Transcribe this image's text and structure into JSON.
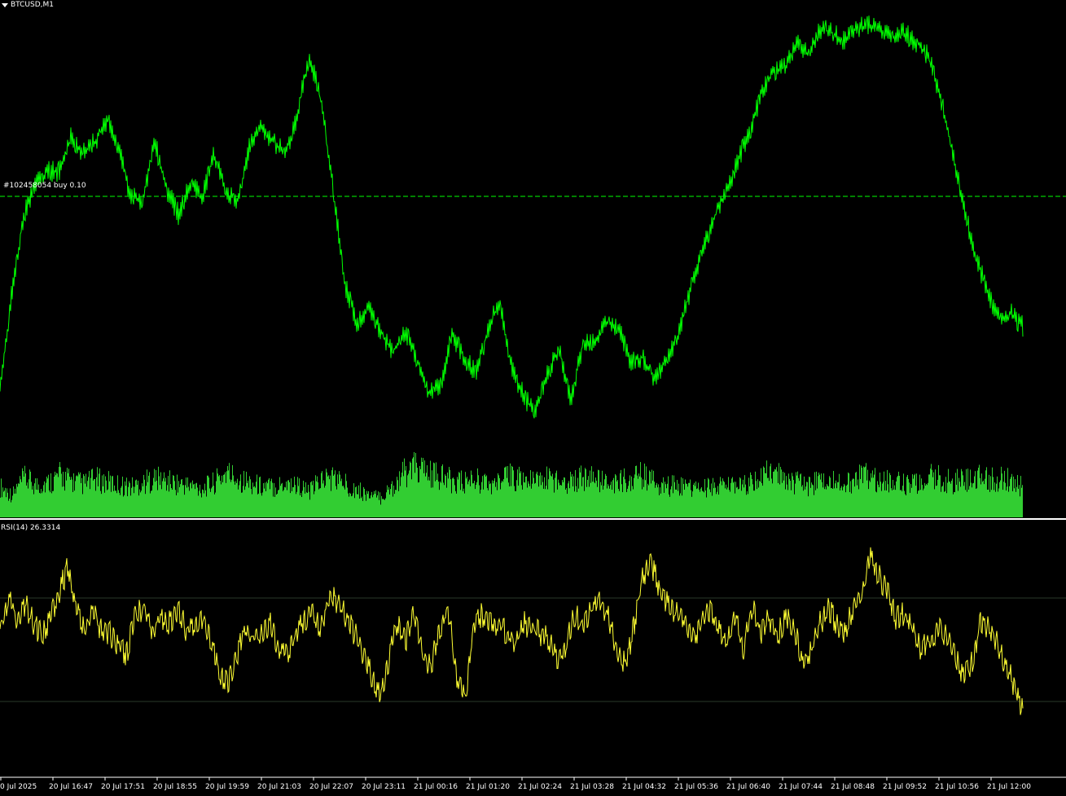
{
  "symbol_title": "BTCUSD,M1",
  "order_label": "#102458054 buy 0.10",
  "rsi_title": "RSI(14) 26.3314",
  "colors": {
    "background": "#000000",
    "price_line": "#00ff00",
    "volume": "#32cd32",
    "rsi_line": "#ffff33",
    "order_line": "#00ff00",
    "separator": "#ffffff"
  },
  "chart_data": [
    {
      "type": "line",
      "name": "price",
      "x_ticks": [
        "0 Jul 2025",
        "20 Jul 16:47",
        "20 Jul 17:51",
        "20 Jul 18:55",
        "20 Jul 19:59",
        "20 Jul 21:03",
        "20 Jul 22:07",
        "20 Jul 23:11",
        "21 Jul 00:16",
        "21 Jul 01:20",
        "21 Jul 02:24",
        "21 Jul 03:28",
        "21 Jul 04:32",
        "21 Jul 05:36",
        "21 Jul 06:40",
        "21 Jul 07:44",
        "21 Jul 08:48",
        "21 Jul 09:52",
        "21 Jul 10:56",
        "21 Jul 12:00"
      ],
      "y_levels": [
        0.15,
        0.38,
        0.56,
        0.63,
        0.66,
        0.66,
        0.74,
        0.7,
        0.73,
        0.78,
        0.71,
        0.6,
        0.59,
        0.73,
        0.62,
        0.56,
        0.63,
        0.6,
        0.7,
        0.61,
        0.59,
        0.72,
        0.76,
        0.73,
        0.7,
        0.79,
        0.93,
        0.82,
        0.62,
        0.4,
        0.31,
        0.34,
        0.29,
        0.24,
        0.29,
        0.23,
        0.15,
        0.16,
        0.28,
        0.23,
        0.19,
        0.29,
        0.36,
        0.21,
        0.14,
        0.1,
        0.19,
        0.25,
        0.13,
        0.26,
        0.26,
        0.31,
        0.3,
        0.22,
        0.23,
        0.18,
        0.22,
        0.28,
        0.38,
        0.47,
        0.55,
        0.61,
        0.68,
        0.75,
        0.84,
        0.89,
        0.9,
        0.96,
        0.93,
        0.99,
        0.98,
        0.96,
        0.99,
        1.0,
        0.99,
        0.97,
        0.98,
        0.96,
        0.93,
        0.84,
        0.72,
        0.58,
        0.47,
        0.38,
        0.32,
        0.33,
        0.3
      ],
      "y_range_px_note": "",
      "order_level": 0.602
    },
    {
      "type": "bar",
      "name": "volume",
      "levels": [
        0.55,
        0.4,
        0.7,
        0.58,
        0.62,
        0.75,
        0.66,
        0.6,
        0.68,
        0.63,
        0.58,
        0.55,
        0.62,
        0.7,
        0.65,
        0.6,
        0.57,
        0.52,
        0.62,
        0.8,
        0.7,
        0.62,
        0.56,
        0.55,
        0.62,
        0.58,
        0.45,
        0.68,
        0.72,
        0.6,
        0.5,
        0.4,
        0.35,
        0.55,
        0.8,
        0.9,
        0.78,
        0.72,
        0.66,
        0.62,
        0.7,
        0.58,
        0.62,
        0.75,
        0.68,
        0.62,
        0.7,
        0.66,
        0.64,
        0.72,
        0.69,
        0.6,
        0.62,
        0.7,
        0.75,
        0.62,
        0.55,
        0.6,
        0.52,
        0.5,
        0.55,
        0.58,
        0.52,
        0.6,
        0.72,
        0.8,
        0.7,
        0.62,
        0.58,
        0.66,
        0.64,
        0.6,
        0.7,
        0.74,
        0.68,
        0.64,
        0.62,
        0.58,
        0.72,
        0.7,
        0.64,
        0.66,
        0.72,
        0.68,
        0.7,
        0.65,
        0.55
      ]
    },
    {
      "type": "line",
      "name": "RSI(14)",
      "value": 26.3314,
      "levels": [
        70,
        30
      ],
      "ylim": [
        0,
        100
      ],
      "values": [
        58,
        70,
        62,
        68,
        60,
        55,
        62,
        72,
        82,
        66,
        58,
        64,
        58,
        56,
        52,
        48,
        64,
        66,
        58,
        62,
        60,
        66,
        58,
        60,
        62,
        52,
        40,
        36,
        48,
        58,
        54,
        56,
        60,
        50,
        48,
        56,
        62,
        64,
        58,
        72,
        68,
        62,
        56,
        48,
        40,
        32,
        46,
        60,
        54,
        64,
        48,
        44,
        58,
        66,
        40,
        30,
        58,
        64,
        60,
        60,
        56,
        52,
        60,
        58,
        56,
        54,
        44,
        52,
        64,
        58,
        66,
        70,
        62,
        50,
        44,
        60,
        78,
        84,
        74,
        68,
        64,
        62,
        54,
        60,
        66,
        58,
        52,
        62,
        50,
        68,
        56,
        62,
        56,
        62,
        58,
        44,
        50,
        60,
        66,
        60,
        56,
        68,
        72,
        86,
        78,
        72,
        62,
        64,
        58,
        50,
        54,
        58,
        56,
        48,
        40,
        46,
        60,
        58,
        52,
        44,
        36,
        26
      ]
    }
  ]
}
